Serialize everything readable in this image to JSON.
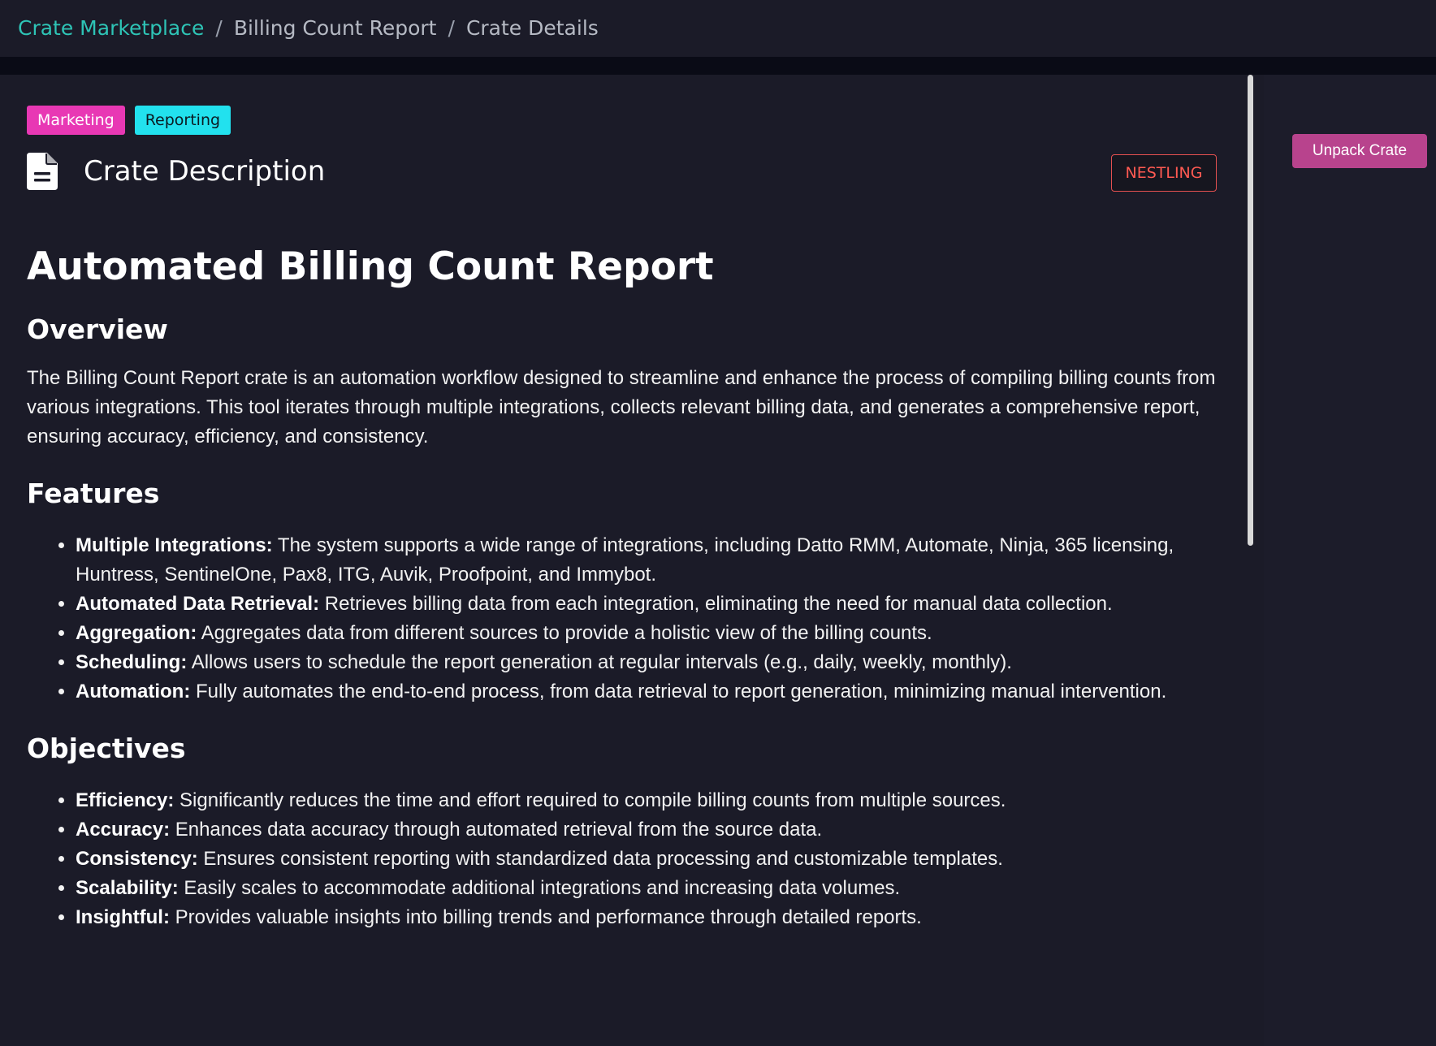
{
  "breadcrumb": {
    "items": [
      {
        "label": "Crate Marketplace",
        "link": true
      },
      {
        "label": "Billing Count Report",
        "link": false
      },
      {
        "label": "Crate Details",
        "link": false
      }
    ]
  },
  "tags": [
    "Marketing",
    "Reporting"
  ],
  "header": {
    "icon": "document-icon",
    "title": "Crate Description",
    "badge": "NESTLING"
  },
  "sidebar": {
    "unpack_label": "Unpack Crate"
  },
  "content": {
    "title": "Automated Billing Count Report",
    "overview": {
      "heading": "Overview",
      "text": "The Billing Count Report crate is an automation workflow designed to streamline and enhance the process of compiling billing counts from various integrations. This tool iterates through multiple integrations, collects relevant billing data, and generates a comprehensive report, ensuring accuracy, efficiency, and consistency."
    },
    "features": {
      "heading": "Features",
      "items": [
        {
          "term": "Multiple Integrations:",
          "text": " The system supports a wide range of integrations, including Datto RMM, Automate, Ninja, 365 licensing, Huntress, SentinelOne, Pax8, ITG, Auvik, Proofpoint, and Immybot."
        },
        {
          "term": "Automated Data Retrieval:",
          "text": " Retrieves billing data from each integration, eliminating the need for manual data collection."
        },
        {
          "term": "Aggregation:",
          "text": " Aggregates data from different sources to provide a holistic view of the billing counts."
        },
        {
          "term": "Scheduling:",
          "text": " Allows users to schedule the report generation at regular intervals (e.g., daily, weekly, monthly)."
        },
        {
          "term": "Automation:",
          "text": " Fully automates the end-to-end process, from data retrieval to report generation, minimizing manual intervention."
        }
      ]
    },
    "objectives": {
      "heading": "Objectives",
      "items": [
        {
          "term": "Efficiency:",
          "text": " Significantly reduces the time and effort required to compile billing counts from multiple sources."
        },
        {
          "term": "Accuracy:",
          "text": " Enhances data accuracy through automated retrieval from the source data."
        },
        {
          "term": "Consistency:",
          "text": " Ensures consistent reporting with standardized data processing and customizable templates."
        },
        {
          "term": "Scalability:",
          "text": " Easily scales to accommodate additional integrations and increasing data volumes."
        },
        {
          "term": "Insightful:",
          "text": " Provides valuable insights into billing trends and performance through detailed reports."
        }
      ]
    }
  },
  "colors": {
    "background": "#1b1b28",
    "link": "#2ec4b6",
    "tag_marketing": "#e838b4",
    "tag_reporting": "#22e1ee",
    "badge": "#ff5a52",
    "button": "#b8438d"
  }
}
